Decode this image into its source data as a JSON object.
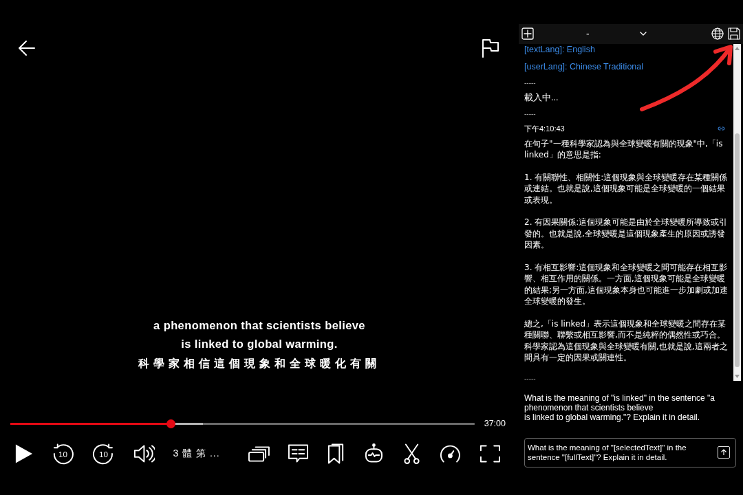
{
  "player": {
    "subtitle": {
      "english": [
        "a phenomenon that scientists believe",
        "is linked to global warming."
      ],
      "translation": "科學家相信這個現象和全球暖化有關"
    },
    "progress": {
      "level": 0.345
    },
    "duration": "37:00",
    "skip_labels": [
      "10",
      "10"
    ],
    "episode_title": "3 體 第 ..."
  },
  "panel": {
    "header": {
      "title": "-"
    },
    "log": [
      {
        "kind": "lang",
        "text": "[textLang]: English"
      },
      {
        "kind": "lang",
        "text": "[userLang]: Chinese Traditional"
      },
      {
        "kind": "divider",
        "text": "-----"
      },
      {
        "kind": "plain",
        "text": "載入中..."
      },
      {
        "kind": "divider",
        "text": "-----"
      }
    ],
    "answer": {
      "time": "下午4:10:43",
      "paragraphs": [
        "在句子\"一種科學家認為與全球變暖有關的現象\"中,「is linked」的意思是指:",
        "1. 有關聯性、相關性:這個現象與全球變暖存在某種關係或連結。也就是說,這個現象可能是全球變暖的一個結果或表現。",
        "2. 有因果關係:這個現象可能是由於全球變暖所導致或引發的。也就是說,全球變暖是這個現象產生的原因或誘發因素。",
        "3. 有相互影響:這個現象和全球變暖之間可能存在相互影響、相互作用的關係。一方面,這個現象可能是全球變暖的結果;另一方面,這個現象本身也可能進一步加劇或加速全球變暖的發生。",
        "總之,「is linked」表示這個現象和全球變暖之間存在某種關聯、聯繫或相互影響,而不是純粹的偶然性或巧合。科學家認為這個現象與全球變暖有關,也就是說,這兩者之間具有一定的因果或關連性。"
      ],
      "divider": "-----"
    },
    "question": [
      "What is the meaning of \"is linked\" in the sentence \"a phenomenon that scientists believe",
      "is linked to global warming.\"? Explain it in detail."
    ],
    "input": {
      "value": "What is the meaning of \"[selectedText]\" in the sentence \"[fullText]\"? Explain it in detail."
    }
  }
}
